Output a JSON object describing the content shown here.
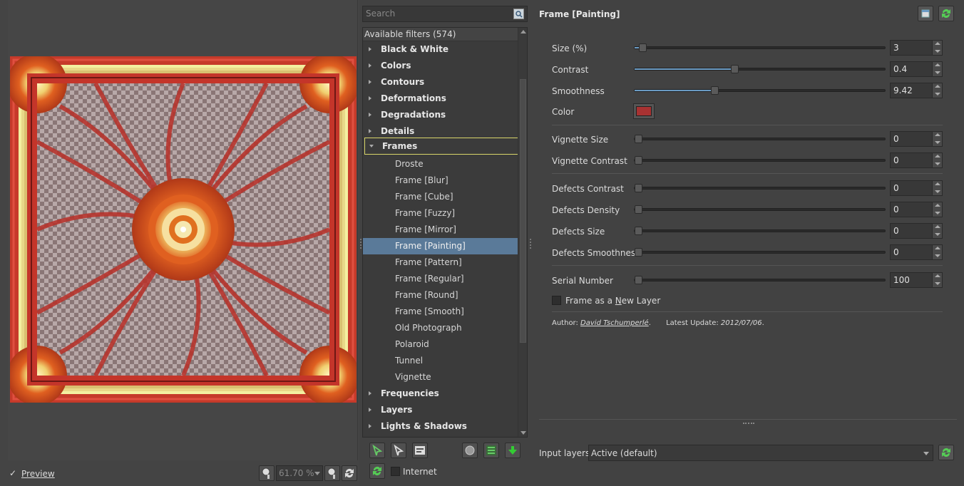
{
  "preview": {
    "checkbox_label": "Preview",
    "checkmark": "✓",
    "zoom_value": "61.70 %"
  },
  "filters": {
    "search_placeholder": "Search",
    "header": "Available filters (574)",
    "categories_top": [
      "Black & White",
      "Colors",
      "Contours",
      "Deformations",
      "Degradations",
      "Details"
    ],
    "expanded_category": "Frames",
    "frames_items": [
      "Droste",
      "Frame [Blur]",
      "Frame [Cube]",
      "Frame [Fuzzy]",
      "Frame [Mirror]",
      "Frame [Painting]",
      "Frame [Pattern]",
      "Frame [Regular]",
      "Frame [Round]",
      "Frame [Smooth]",
      "Old Photograph",
      "Polaroid",
      "Tunnel",
      "Vignette"
    ],
    "selected_item": "Frame [Painting]",
    "categories_bottom": [
      "Frequencies",
      "Layers",
      "Lights & Shadows"
    ],
    "internet_label": "Internet"
  },
  "params": {
    "title": "Frame [Painting]",
    "size_label": "Size (%)",
    "size_value": "3",
    "size_frac": 0.03,
    "contrast_label": "Contrast",
    "contrast_value": "0.4",
    "contrast_frac": 0.4,
    "smoothness_label": "Smoothness",
    "smoothness_value": "9.42",
    "smoothness_frac": 0.32,
    "color_label": "Color",
    "color_value": "#a83232",
    "vignette_size_label": "Vignette Size",
    "vignette_size_value": "0",
    "vignette_contrast_label": "Vignette Contrast",
    "vignette_contrast_value": "0",
    "defects_contrast_label": "Defects Contrast",
    "defects_contrast_value": "0",
    "defects_density_label": "Defects Density",
    "defects_density_value": "0",
    "defects_size_label": "Defects Size",
    "defects_size_value": "0",
    "defects_smoothness_label": "Defects Smoothness",
    "defects_smoothness_value": "0",
    "serial_label": "Serial Number",
    "serial_value": "100",
    "new_layer_pre": "Frame as a ",
    "new_layer_u": "N",
    "new_layer_post": "ew Layer",
    "author_prefix": "Author: ",
    "author_name": "David Tschumperlé",
    "author_dot": ".",
    "update_prefix": "Latest Update: ",
    "update_date": "2012/07/06",
    "update_dot": "."
  },
  "input_layers": {
    "label": "Input layers",
    "value": "Active (default)"
  },
  "colors": {
    "selection": "#5a7a99",
    "slider_fill": "#6b9bc4",
    "highlight_outline": "#d9d66a",
    "frame_red": "#c63a2a"
  }
}
